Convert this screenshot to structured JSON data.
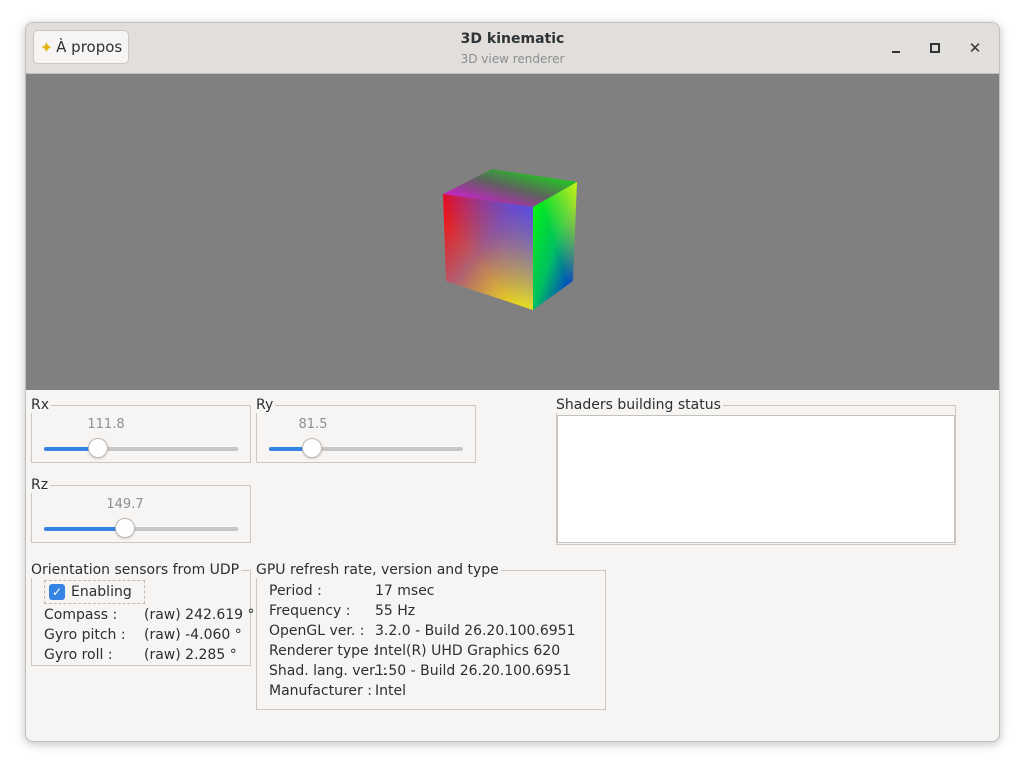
{
  "header": {
    "about_label": "À propos",
    "title": "3D kinematic",
    "subtitle": "3D view renderer"
  },
  "sliders": {
    "rx": {
      "label": "Rx",
      "value": "111.8",
      "fraction": 0.28
    },
    "ry": {
      "label": "Ry",
      "value": "81.5",
      "fraction": 0.22
    },
    "rz": {
      "label": "Rz",
      "value": "149.7",
      "fraction": 0.42
    }
  },
  "shaders": {
    "label": "Shaders building status",
    "content": ""
  },
  "sensors": {
    "label": "Orientation sensors from UDP",
    "enabling_label": "Enabling",
    "enabling_checked": true,
    "rows": [
      {
        "name": "Compass :",
        "value": "(raw) 242.619 °"
      },
      {
        "name": "Gyro pitch :",
        "value": "(raw) -4.060 °"
      },
      {
        "name": "Gyro roll :",
        "value": "(raw) 2.285 °"
      }
    ]
  },
  "gpu": {
    "label": "GPU refresh rate, version and type",
    "rows": [
      {
        "name": "Period :",
        "value": "17 msec"
      },
      {
        "name": "Frequency :",
        "value": "55 Hz"
      },
      {
        "name": "OpenGL ver. :",
        "value": "3.2.0 - Build 26.20.100.6951"
      },
      {
        "name": "Renderer type :",
        "value": "Intel(R) UHD Graphics 620"
      },
      {
        "name": "Shad. lang. ver. :",
        "value": "1.50 - Build 26.20.100.6951"
      },
      {
        "name": "Manufacturer :",
        "value": "Intel"
      }
    ]
  },
  "colors": {
    "accent": "#3584e4",
    "viewport_bg": "#808080",
    "window_bg": "#f6f5f4"
  }
}
